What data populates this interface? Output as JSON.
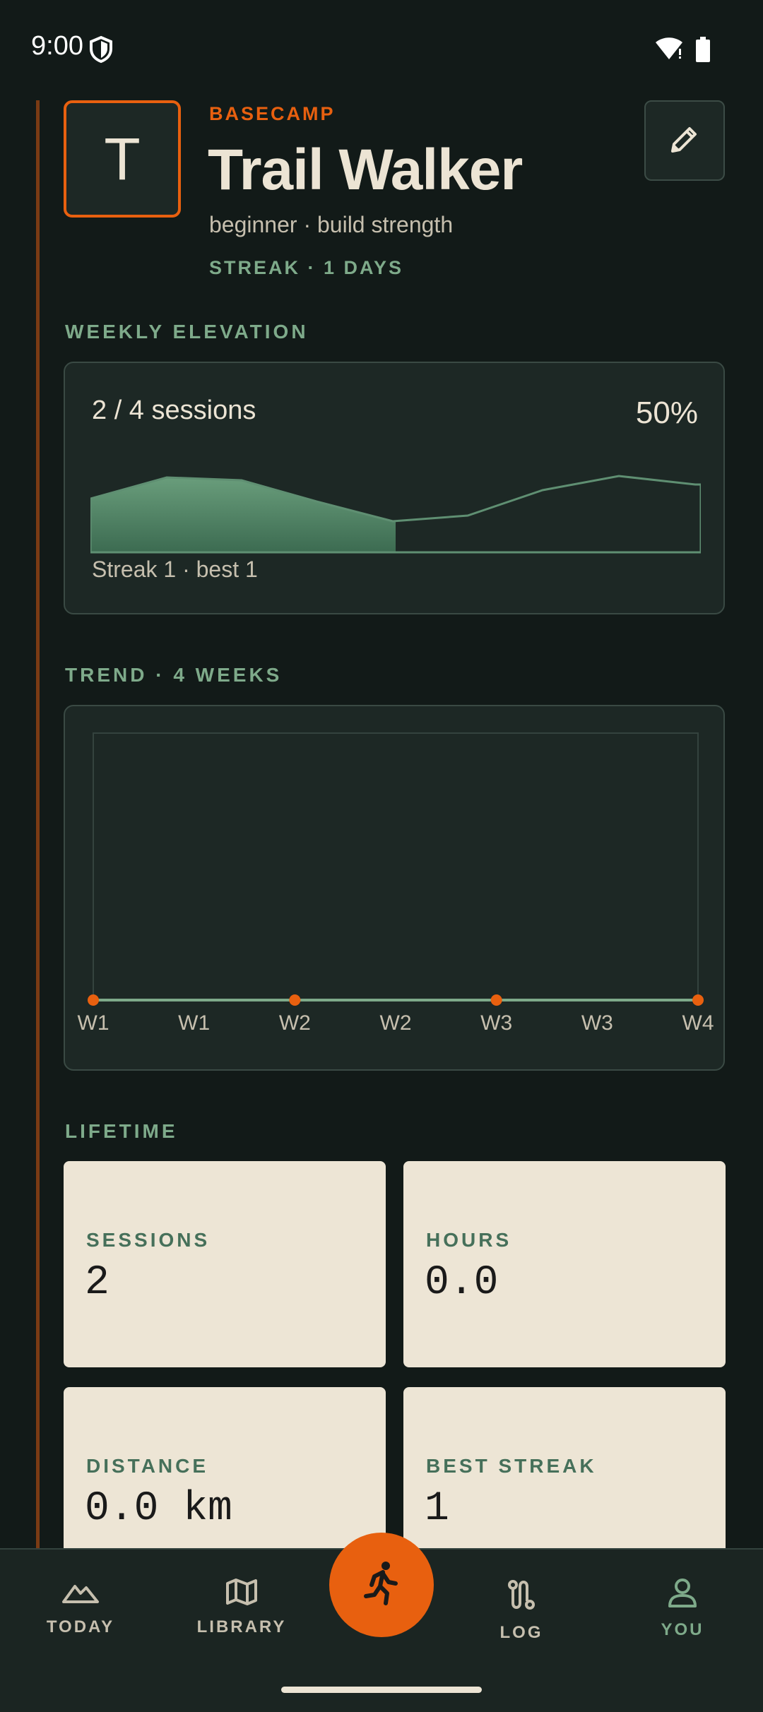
{
  "status_bar": {
    "time": "9:00"
  },
  "header": {
    "avatar_letter": "T",
    "kicker": "BASECAMP",
    "title": "Trail Walker",
    "subtitle": "beginner · build strength",
    "streak": "STREAK · 1 DAYS",
    "edit_icon": "pencil-icon"
  },
  "weekly": {
    "section_label": "WEEKLY ELEVATION",
    "sessions_text": "2 / 4 sessions",
    "percent_text": "50%",
    "progress_fraction": 0.5,
    "footer": "Streak 1 · best 1"
  },
  "trend": {
    "section_label": "TREND · 4 WEEKS",
    "tick_labels": [
      "W1",
      "W1",
      "W2",
      "W2",
      "W3",
      "W3",
      "W4"
    ]
  },
  "chart_data": {
    "type": "line",
    "x": [
      "W1",
      "W2",
      "W3",
      "W4"
    ],
    "series": [
      {
        "values": [
          0,
          0,
          0,
          0
        ]
      }
    ],
    "tick_labels": [
      "W1",
      "W1",
      "W2",
      "W2",
      "W3",
      "W3",
      "W4"
    ],
    "grid": false
  },
  "lifetime": {
    "section_label": "LIFETIME",
    "stats": [
      {
        "label": "SESSIONS",
        "value": "2"
      },
      {
        "label": "HOURS",
        "value": "0.0"
      },
      {
        "label": "DISTANCE",
        "value": "0.0 km"
      },
      {
        "label": "BEST STREAK",
        "value": "1"
      }
    ]
  },
  "nav": {
    "items": [
      {
        "label": "TODAY",
        "icon": "mountain-icon"
      },
      {
        "label": "LIBRARY",
        "icon": "map-icon"
      },
      {
        "label": "LOG",
        "icon": "route-icon"
      },
      {
        "label": "YOU",
        "icon": "person-icon",
        "active": true
      }
    ],
    "fab_icon": "running-person-icon"
  },
  "colors": {
    "background": "#121a18",
    "accent": "#e8600f",
    "green": "#7eaa8a",
    "card": "#1d2825",
    "tile": "#ede5d5"
  }
}
